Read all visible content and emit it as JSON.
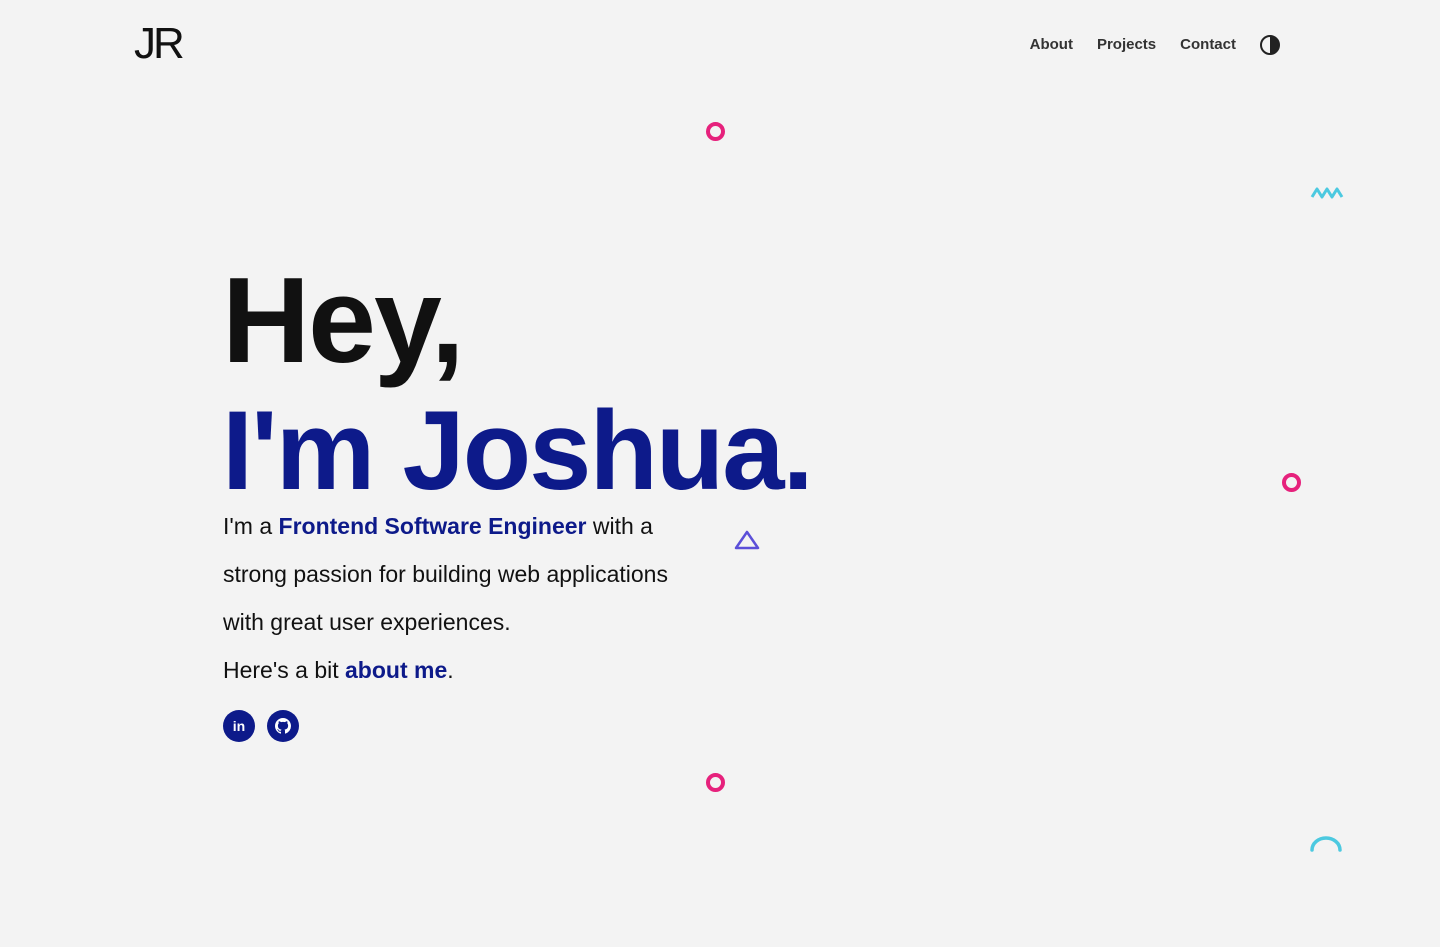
{
  "header": {
    "logo": "JR",
    "nav": [
      {
        "label": "About"
      },
      {
        "label": "Projects"
      },
      {
        "label": "Contact"
      }
    ],
    "theme_toggle_icon": "contrast-icon"
  },
  "hero": {
    "greeting": "Hey,",
    "name": "I'm Joshua.",
    "intro_prefix": "I'm a ",
    "intro_role": "Frontend Software Engineer",
    "intro_suffix": " with a strong passion for building web applications with great user experiences.",
    "about_prefix": "Here's a bit ",
    "about_link": "about me",
    "about_suffix": "."
  },
  "socials": [
    {
      "name": "linkedin",
      "label": "in",
      "icon": "linkedin-icon"
    },
    {
      "name": "github",
      "icon": "github-icon"
    }
  ],
  "colors": {
    "accent": "#0d1a8a",
    "pink": "#e6217c",
    "cyan": "#4cc9e0",
    "purple": "#5b4fd8"
  }
}
